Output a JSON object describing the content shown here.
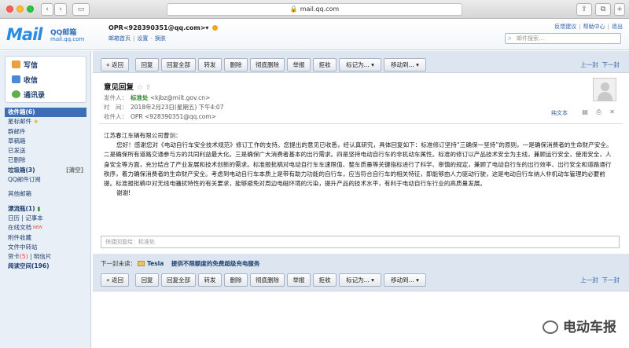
{
  "browser": {
    "url": "mail.qq.com",
    "back": "‹",
    "forward": "›",
    "sidebar_btn": "▭",
    "share": "⇪",
    "tabs": "⧉"
  },
  "header": {
    "logo_mail": "Mail",
    "logo_qq": "QQ邮箱",
    "logo_url": "mail.qq.com",
    "account": "OPR<928390351@qq.com>",
    "account_arrow": "▾",
    "links": [
      "邮箱首页",
      "设置",
      "换肤"
    ],
    "top_links": [
      "反馈建议",
      "帮助中心",
      "退出"
    ],
    "search_placeholder": "邮件搜索..."
  },
  "sidebar": {
    "compose": "写信",
    "inbox_btn": "收信",
    "contacts": "通讯录",
    "folders": [
      {
        "label": "收件箱(6)",
        "active": true
      },
      {
        "label": "星标邮件",
        "star": true
      },
      {
        "label": "群邮件"
      },
      {
        "label": "草稿箱"
      },
      {
        "label": "已发送"
      },
      {
        "label": "已删除"
      },
      {
        "label": "垃圾箱(3)",
        "right": "[清空]",
        "bold": true
      },
      {
        "label": "QQ邮件订阅"
      }
    ],
    "other_mailbox": "其他邮箱",
    "bottle": "漂流瓶(1)",
    "calendar": "日历",
    "notebook": "记事本",
    "online_docs": "在线文档",
    "new_badge": "NEW",
    "attachments": "附件收藏",
    "file_transfer": "文件中转站",
    "greetings": "贺卡",
    "greetings_count": "(5)",
    "postcard": "明信片",
    "reading_space": "阅读空间(196)"
  },
  "toolbar": {
    "back": "« 返回",
    "reply": "回复",
    "reply_all": "回复全部",
    "forward": "转发",
    "delete": "删除",
    "perm_delete": "彻底删除",
    "report": "举报",
    "reject": "拒收",
    "mark_as": "标记为... ▾",
    "move_to": "移动到... ▾",
    "prev": "上一封",
    "next": "下一封"
  },
  "email": {
    "subject": "意见回复",
    "subject_stars": "☆ ⇧",
    "from_label": "发件人：",
    "from_name": "标准处",
    "from_addr": "<kjbz@miit.gov.cn>",
    "time_label": "时　间：",
    "time": "2018年2月23日(星期五) 下午4:07",
    "to_label": "收件人：",
    "to": "OPR <928390351@qq.com>",
    "plain_text": "纯文本",
    "header_icons": "▤ ⎙ ✕",
    "greeting": "江苏春江车辆有限公司曹剑：",
    "body": "您好！感谢您对《电动自行车安全技术规范》修订工作的支持。您提出的意见已收悉，经认真研究，具体回复如下：标准修订坚持“三确保一坚持”的原则，一是确保消费者的生命财产安全。二是确保所有道路交通参与方的共同利益最大化。三是确保广大消费者基本的出行需求。四是坚持电动自行车的非机动车属性。标准的修订以产品技术安全为主线，兼顾运行安全，使用安全，人身安全等方面，充分结合了产业发展和技术创新的需求。标准报批稿对电动自行车车速限值、整车质量等关键指标进行了科学、审慎的规定，兼顾了电动自行车的出行效率、出行安全和道路通行秩序，着力确保消费者的生命财产安全。考虑到电动自行车本质上是带有助力功能的自行车，应当符合自行车的相关特征，即能够由人力驱动行驶，这是电动自行车纳入非机动车管理的必要前提。标准报批稿中对无线电骚扰特性的有关要求，能够避免对周边电磁环境的污染，提升产品的技术水平，有利于电动自行车行业的高质量发展。",
    "thanks": "谢谢!",
    "quick_reply": "快捷回复给：标准处"
  },
  "next_mail": {
    "label": "下一封未读：",
    "sender": "Tesla",
    "subject": "提供不限额度的免费超级充电服务"
  },
  "watermark": "电动车报",
  "colors": {
    "accent": "#3d6eb5",
    "toolbar_strip": "#dde6f0",
    "sidebar_bg": "#e9eff6",
    "logo_blue": "#2b8be0"
  }
}
